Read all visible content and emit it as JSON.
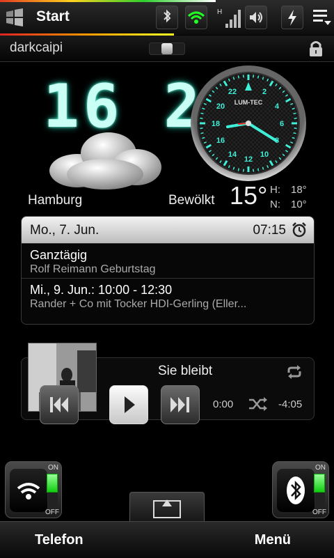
{
  "status_bar": {
    "title": "Start",
    "icons": [
      "windows-start-icon",
      "bluetooth-icon",
      "wifi-icon",
      "signal-h-icon",
      "volume-icon",
      "charging-icon",
      "menu-lines-icon"
    ]
  },
  "lock_row": {
    "owner": "darkcaipi"
  },
  "clock": {
    "digital_time": "16 20"
  },
  "analog_clock": {
    "brand": "LUM-TEC",
    "hour_labels": [
      "22",
      "2",
      "20",
      "4",
      "18",
      "6",
      "16",
      "8",
      "14",
      "10",
      "12"
    ]
  },
  "weather": {
    "city": "Hamburg",
    "condition": "Bewölkt",
    "temperature": "15°",
    "high_label": "H:",
    "high": "18°",
    "low_label": "N:",
    "low": "10°"
  },
  "calendar": {
    "date": "Mo., 7. Jun.",
    "alarm_time": "07:15",
    "events": [
      {
        "title": "Ganztägig",
        "subtitle": "Rolf Reimann Geburtstag"
      },
      {
        "title": "Mi., 9. Jun.: 10:00 - 12:30",
        "subtitle": "Rander + Co mit Tocker HDI-Gerling (Eller..."
      }
    ]
  },
  "music": {
    "track": "Sie bleibt",
    "elapsed": "0:00",
    "remaining": "-4:05"
  },
  "toggles": {
    "on_label": "ON",
    "off_label": "OFF"
  },
  "softkeys": {
    "left": "Telefon",
    "right": "Menü"
  },
  "colors": {
    "accent_cyan": "#28e0c8",
    "toggle_green": "#22cc22"
  }
}
